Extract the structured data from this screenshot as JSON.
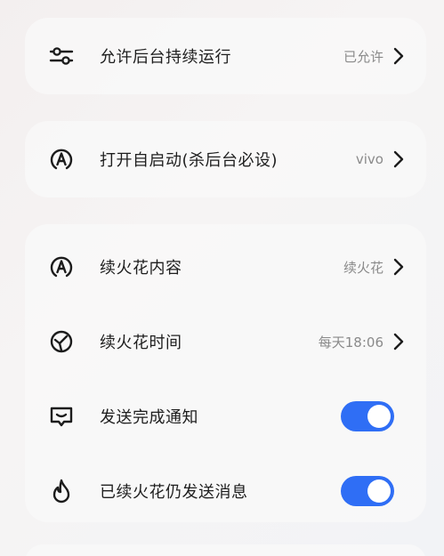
{
  "settings": {
    "background_run": {
      "label": "允许后台持续运行",
      "value": "已允许",
      "icon": "sliders-icon"
    },
    "auto_start": {
      "label": "打开自启动(杀后台必设)",
      "value": "vivo",
      "icon": "a-badge-icon"
    },
    "streak_content": {
      "label": "续火花内容",
      "value": "续火花",
      "icon": "a-badge-icon"
    },
    "streak_time": {
      "label": "续火花时间",
      "value": "每天18:06",
      "icon": "clock-icon"
    },
    "send_notify": {
      "label": "发送完成通知",
      "on": true,
      "icon": "message-icon"
    },
    "continue_send": {
      "label": "已续火花仍发送消息",
      "on": true,
      "icon": "flame-icon"
    }
  },
  "colors": {
    "toggle_on": "#2f6ef5",
    "value_text": "#8a8a8a"
  }
}
